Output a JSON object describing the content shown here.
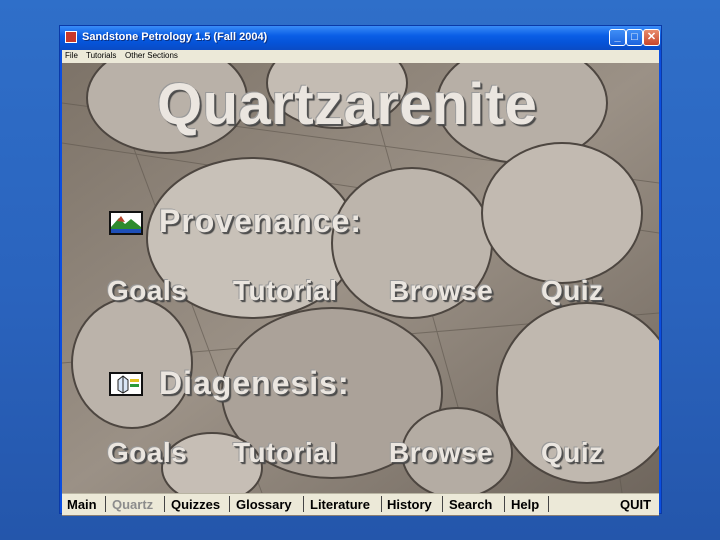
{
  "window": {
    "title": "Sandstone Petrology 1.5 (Fall 2004)",
    "menu": [
      "File",
      "Tutorials",
      "Other Sections"
    ]
  },
  "page": {
    "heading": "Quartzarenite"
  },
  "sections": [
    {
      "title": "Provenance:",
      "icon": "landscape-icon",
      "links": [
        "Goals",
        "Tutorial",
        "Browse",
        "Quiz"
      ]
    },
    {
      "title": "Diagenesis:",
      "icon": "crystal-icon",
      "links": [
        "Goals",
        "Tutorial",
        "Browse",
        "Quiz"
      ]
    }
  ],
  "navbar": {
    "items": [
      "Main",
      "Quartz",
      "Quizzes",
      "Glossary",
      "Literature",
      "History",
      "Search",
      "Help"
    ],
    "current": "Quartz",
    "quit": "QUIT"
  },
  "colors": {
    "desktop": "#2a63bd",
    "titlebar": "#0553d8",
    "menubar": "#ece9d8",
    "overlay_text": "#ebe6e0"
  }
}
